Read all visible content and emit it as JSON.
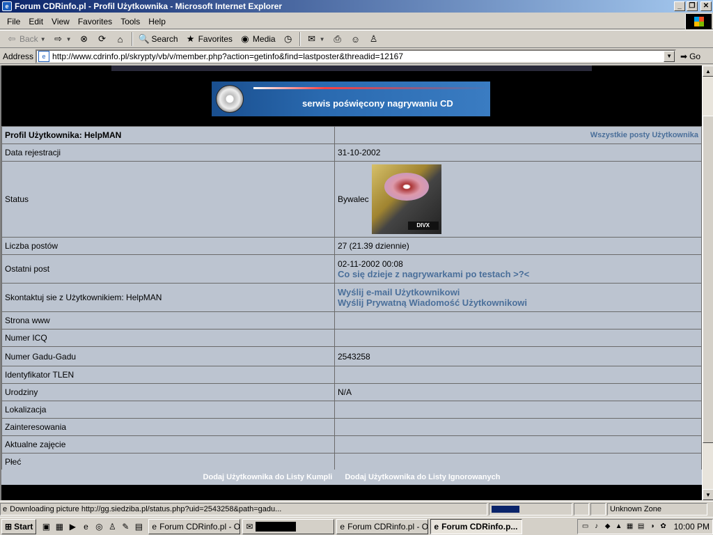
{
  "window": {
    "title": "Forum CDRinfo.pl - Profil Użytkownika - Microsoft Internet Explorer",
    "buttons": [
      "_",
      "❐",
      "✕"
    ]
  },
  "menu": [
    "File",
    "Edit",
    "View",
    "Favorites",
    "Tools",
    "Help"
  ],
  "toolbar": {
    "back": "Back",
    "search": "Search",
    "favorites": "Favorites",
    "media": "Media"
  },
  "address": {
    "label": "Address",
    "url": "http://www.cdrinfo.pl/skrypty/vb/v/member.php?action=getinfo&find=lastposter&threadid=12167",
    "go": "Go"
  },
  "banner": {
    "text": "serwis poświęcony nagrywaniu CD"
  },
  "profile": {
    "title": "Profil Użytkownika: HelpMAN",
    "all_posts": "Wszystkie posty Użytkownika",
    "rows": [
      {
        "label": "Data rejestracji",
        "value": "31-10-2002"
      },
      {
        "label": "Status",
        "value": "Bywalec"
      },
      {
        "label": "Liczba postów",
        "value": "27 (21.39 dziennie)"
      },
      {
        "label": "Ostatni post",
        "value": "02-11-2002 00:08",
        "link": "Co się dzieje z nagrywarkami po testach >?<"
      },
      {
        "label": "Skontaktuj sie z Użytkownikiem: HelpMAN",
        "link1": "Wyślij e-mail Użytkownikowi",
        "link2": "Wyślij Prywatną Wiadomość Użytkownikowi"
      },
      {
        "label": "Strona www",
        "value": ""
      },
      {
        "label": "Numer ICQ",
        "value": ""
      },
      {
        "label": "Numer Gadu-Gadu",
        "value": "2543258"
      },
      {
        "label": "Identyfikator TLEN",
        "value": ""
      },
      {
        "label": "Urodziny",
        "value": "N/A"
      },
      {
        "label": "Lokalizacja",
        "value": ""
      },
      {
        "label": "Zainteresowania",
        "value": ""
      },
      {
        "label": "Aktualne zajęcie",
        "value": ""
      },
      {
        "label": "Płeć",
        "value": ""
      }
    ],
    "avatar_badge": "DIVX"
  },
  "actions": {
    "add_friend": "Dodaj Użytkownika do Listy Kumpli",
    "add_ignore": "Dodaj Użytkownika do Listy Ignorowanych"
  },
  "status": {
    "text": "Downloading picture http://gg.siedziba.pl/status.php?uid=2543258&path=gadu...",
    "zone": "Unknown Zone",
    "progress": 0.2
  },
  "taskbar": {
    "start": "Start",
    "tasks": [
      "Forum CDRinfo.pl - O...",
      "",
      "Forum CDRinfo.pl - O...",
      "Forum CDRinfo.p..."
    ],
    "clock": "10:00 PM"
  },
  "colors": {
    "table_bg": "#bcc4d0",
    "link": "#4a6f9a",
    "titlebar_start": "#0a246a",
    "titlebar_end": "#a6caf0"
  }
}
